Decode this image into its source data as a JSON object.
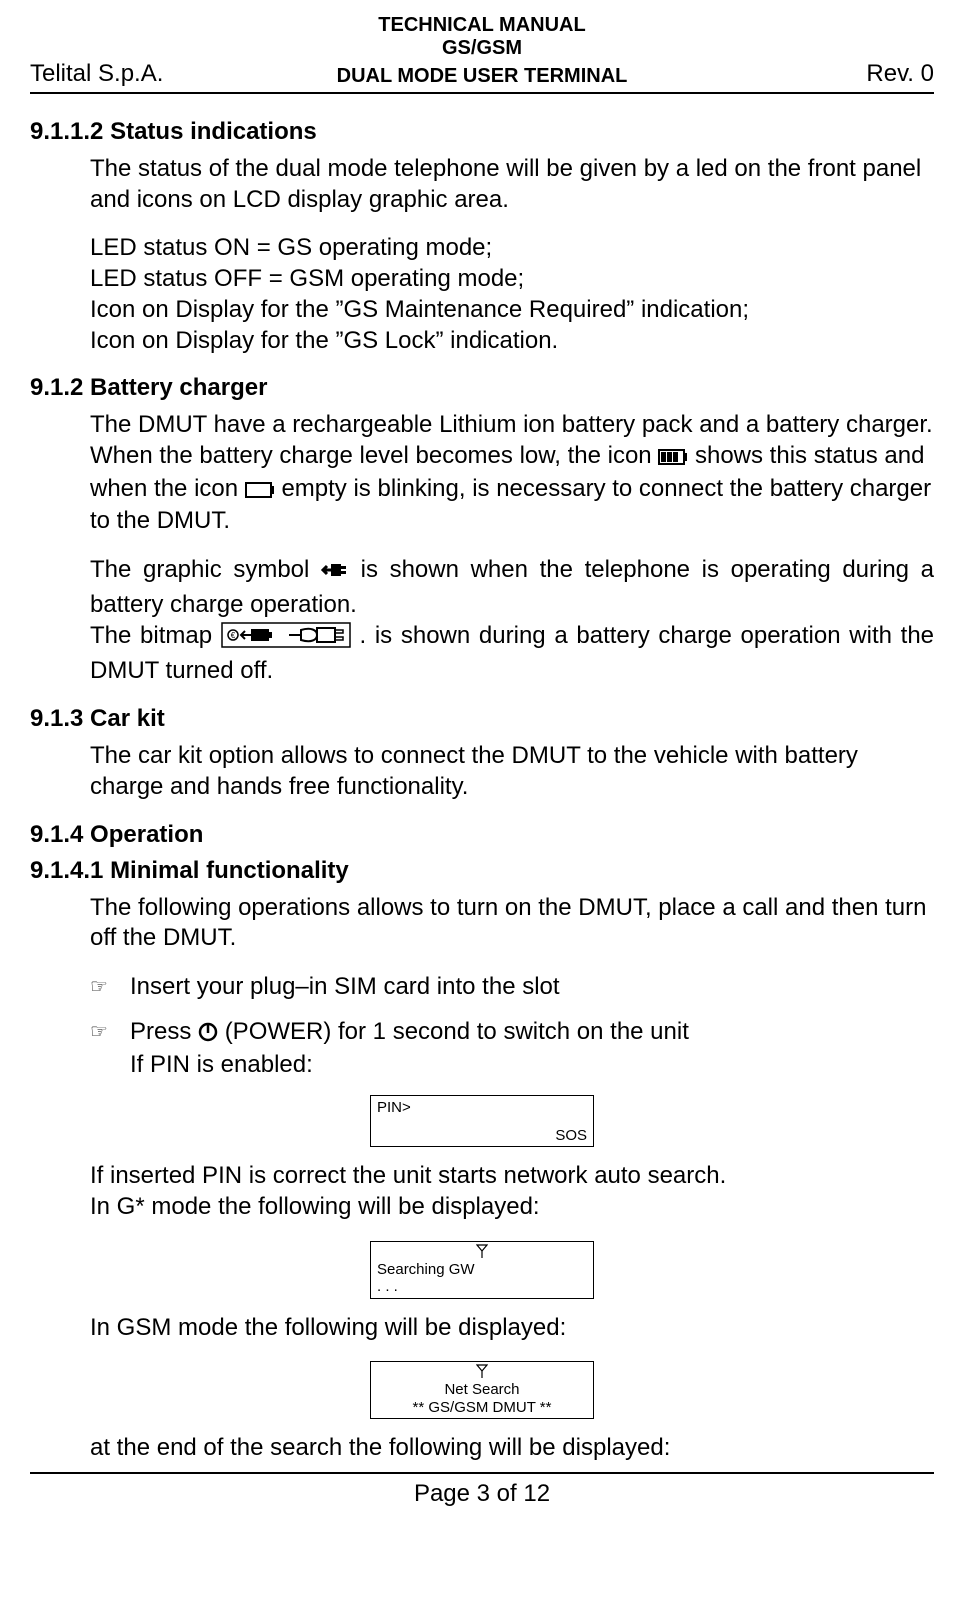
{
  "header": {
    "line1": "TECHNICAL MANUAL",
    "line2": "GS/GSM",
    "line3": "DUAL MODE USER TERMINAL",
    "left": "Telital S.p.A.",
    "right": "Rev. 0"
  },
  "s1": {
    "num": "9.1.1.2 Status indications",
    "p1": "The status of the dual mode telephone will be given by a led on the front panel and icons on LCD display graphic area.",
    "p2a": "LED status ON = GS operating mode;",
    "p2b": "LED status OFF = GSM operating mode;",
    "p2c": "Icon on Display for the ”GS Maintenance Required” indication;",
    "p2d": "Icon on Display for the ”GS Lock” indication."
  },
  "s2": {
    "num": "9.1.2 Battery charger",
    "p1a": "The DMUT have a rechargeable Lithium ion battery pack and a battery charger.",
    "p1b_pre": "When the battery charge level becomes low, the icon ",
    "p1b_post": " shows this status and when the icon ",
    "p1b_tail": " empty is blinking, is necessary to connect the battery charger to the DMUT.",
    "p2_pre": "The graphic symbol ",
    "p2_post": " is shown when the telephone is operating during a battery charge operation.",
    "p3_pre": "The bitmap ",
    "p3_post": ". is shown during a battery charge operation with the DMUT turned off."
  },
  "s3": {
    "num": "9.1.3 Car kit",
    "p1": "The car kit option allows to connect the DMUT to the vehicle with battery charge and hands free functionality."
  },
  "s4": {
    "num": "9.1.4 Operation"
  },
  "s5": {
    "num": "9.1.4.1 Minimal functionality",
    "p1": "The following operations allows to turn on the DMUT,  place a call and then turn off the DMUT.",
    "i1": "Insert your plug–in SIM card into the slot",
    "i2_pre": "Press  ",
    "i2_post": "  (POWER) for 1 second to switch on the unit",
    "i2b": "If PIN is enabled:",
    "lcd1_top": "PIN>",
    "lcd1_sos": "SOS",
    "p2": "If inserted PIN is correct the unit starts network auto search.",
    "p3": "In G* mode the following will be displayed:",
    "lcd2_l1": "Searching GW",
    "lcd2_l2": ". . .",
    "p4": "In GSM mode the following will be displayed:",
    "lcd3_l1": "Net Search",
    "lcd3_l2": "** GS/GSM DMUT **",
    "p5": "at the end of the search the following will be displayed:"
  },
  "footer": {
    "text": "Page 3 of 12"
  }
}
